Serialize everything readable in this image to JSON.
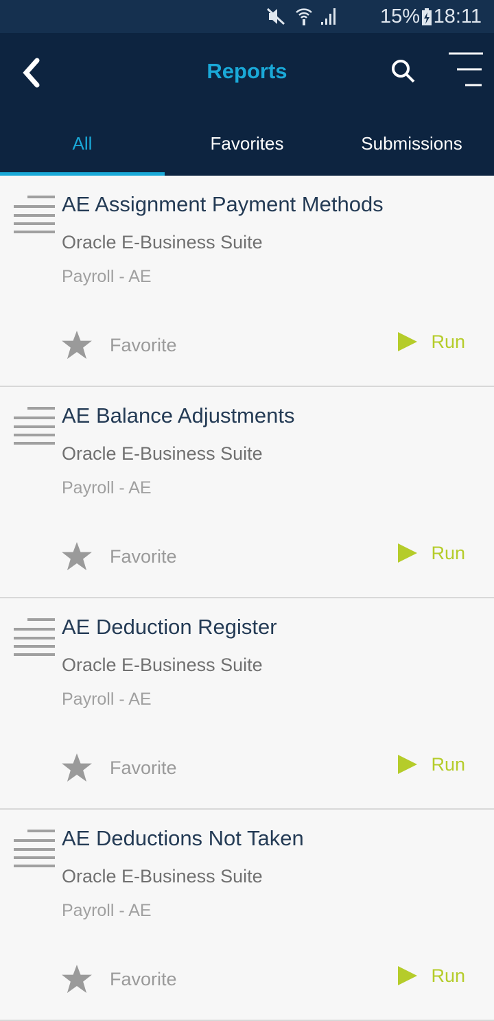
{
  "status_bar": {
    "battery": "15%",
    "time": "18:11",
    "icons": [
      "mute-icon",
      "wifi-icon",
      "signal-icon",
      "battery-charging-icon"
    ]
  },
  "header": {
    "title": "Reports",
    "back_icon": "chevron-left-icon",
    "search_icon": "search-icon",
    "menu_icon": "menu-icon"
  },
  "tabs": [
    {
      "label": "All",
      "active": true
    },
    {
      "label": "Favorites"
    },
    {
      "label": "Submissions"
    }
  ],
  "colors": {
    "accent": "#1aa9d8",
    "run": "#b5cc2a",
    "header_bg": "#0d2440"
  },
  "reports": [
    {
      "name": "AE Assignment Payment Methods",
      "suite": "Oracle E-Business Suite",
      "category": "Payroll - AE",
      "favorite_label": "Favorite",
      "run_label": "Run"
    },
    {
      "name": "AE Balance Adjustments",
      "suite": "Oracle E-Business Suite",
      "category": "Payroll - AE",
      "favorite_label": "Favorite",
      "run_label": "Run"
    },
    {
      "name": "AE Deduction Register",
      "suite": "Oracle E-Business Suite",
      "category": "Payroll - AE",
      "favorite_label": "Favorite",
      "run_label": "Run"
    },
    {
      "name": "AE Deductions Not Taken",
      "suite": "Oracle E-Business Suite",
      "category": "Payroll - AE",
      "favorite_label": "Favorite",
      "run_label": "Run"
    }
  ]
}
